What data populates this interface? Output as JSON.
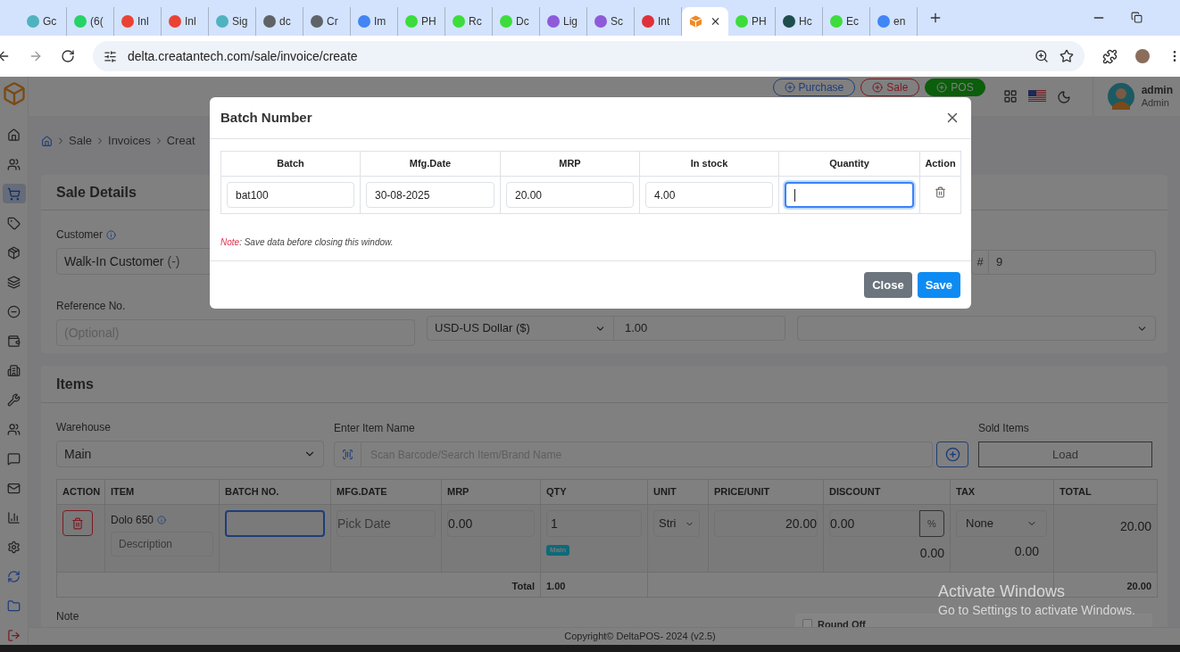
{
  "browser": {
    "tabs": [
      {
        "title": "Gc",
        "selected": false,
        "color": "#4fb3bf"
      },
      {
        "title": "(6(",
        "selected": false,
        "color": "#25d366"
      },
      {
        "title": "Inl",
        "selected": false,
        "color": "#ea4335"
      },
      {
        "title": "Inl",
        "selected": false,
        "color": "#ea4335"
      },
      {
        "title": "Sig",
        "selected": false,
        "color": "#4fb3bf"
      },
      {
        "title": "dc",
        "selected": false,
        "color": "#5f6368"
      },
      {
        "title": "Cr",
        "selected": false,
        "color": "#5f6368"
      },
      {
        "title": "Im",
        "selected": false,
        "color": "#4285f4"
      },
      {
        "title": "PH",
        "selected": false,
        "color": "#3ddc3d"
      },
      {
        "title": "Rc",
        "selected": false,
        "color": "#3ddc3d"
      },
      {
        "title": "Dc",
        "selected": false,
        "color": "#3ddc3d"
      },
      {
        "title": "Lig",
        "selected": false,
        "color": "#8e5bd8"
      },
      {
        "title": "Sc",
        "selected": false,
        "color": "#8e5bd8"
      },
      {
        "title": "Int",
        "selected": false,
        "color": "#e0303a"
      },
      {
        "selected": true,
        "color": "#f08a24"
      },
      {
        "title": "PH",
        "selected": false,
        "color": "#3ddc3d"
      },
      {
        "title": "Hc",
        "selected": false,
        "color": "#1e4d4d"
      },
      {
        "title": "Ec",
        "selected": false,
        "color": "#3ddc3d"
      },
      {
        "title": "en",
        "selected": false,
        "color": "#4285f4"
      }
    ],
    "url": "delta.creatantech.com/sale/invoice/create"
  },
  "sidebar": {
    "items": [
      {
        "selected": false
      },
      {
        "selected": false
      },
      {
        "selected": true
      },
      {
        "selected": false
      },
      {
        "selected": false
      },
      {
        "selected": false
      },
      {
        "selected": false
      },
      {
        "selected": false
      },
      {
        "selected": false
      },
      {
        "selected": false
      },
      {
        "selected": false
      },
      {
        "selected": false
      },
      {
        "selected": false
      },
      {
        "selected": false
      },
      {
        "selected": false
      },
      {
        "selected": false
      },
      {
        "selected": false
      },
      {
        "selected": false
      }
    ]
  },
  "header": {
    "buttons": [
      {
        "label": "Purchase",
        "kind": "purchase"
      },
      {
        "label": "Sale",
        "kind": "sale"
      },
      {
        "label": "POS",
        "kind": "pos"
      }
    ],
    "user": {
      "name": "admin",
      "role": "Admin"
    }
  },
  "breadcrumb": [
    "Sale",
    "Invoices",
    "Creat"
  ],
  "sale_details": {
    "title": "Sale Details",
    "customer_label": "Customer",
    "customer": "Walk-In Customer",
    "customer_suffix": "(-)",
    "number_prefix": "#",
    "number": "9",
    "reference_label": "Reference No.",
    "reference_placeholder": "(Optional)",
    "currency": "USD-US Dollar ($)",
    "exchange_rate": "1.00"
  },
  "items": {
    "title": "Items",
    "warehouse_label": "Warehouse",
    "warehouse": "Main",
    "search_label": "Enter Item Name",
    "search_placeholder": "Scan Barcode/Search Item/Brand Name",
    "sold_items_label": "Sold Items",
    "load_button": "Load",
    "columns": [
      "ACTION",
      "ITEM",
      "BATCH NO.",
      "MFG.DATE",
      "MRP",
      "QTY",
      "UNIT",
      "PRICE/UNIT",
      "DISCOUNT",
      "TAX",
      "TOTAL"
    ],
    "rows": [
      {
        "item": "Dolo 650",
        "description_placeholder": "Description",
        "batch": "",
        "mfg_placeholder": "Pick Date",
        "mrp": "0.00",
        "qty": "1",
        "warehouse_badge": "Main",
        "unit": "Stri",
        "price": "20.00",
        "discount": "0.00",
        "discount_type": "%",
        "discount_amount": "0.00",
        "tax": "None",
        "tax_amount": "0.00",
        "total": "20.00"
      }
    ],
    "total_label": "Total",
    "total_qty": "1.00",
    "total_amount": "20.00"
  },
  "note_label": "Note",
  "round_off": {
    "label": "Round Off",
    "checked": false
  },
  "footer": "Copyright© DeltaPOS- 2024 (v2.5)",
  "os_notice": {
    "title": "Activate Windows",
    "text": "Go to Settings to activate Windows."
  },
  "modal": {
    "title": "Batch Number",
    "columns": [
      "Batch",
      "Mfg.Date",
      "MRP",
      "In stock",
      "Quantity",
      "Action"
    ],
    "rows": [
      {
        "batch": "bat100",
        "mfg_date": "30-08-2025",
        "mrp": "20.00",
        "in_stock": "4.00",
        "quantity": ""
      }
    ],
    "note_label": "Note",
    "note_text": ": Save data before closing this window.",
    "buttons": [
      {
        "label": "Close",
        "kind": "secondary"
      },
      {
        "label": "Save",
        "kind": "primary"
      }
    ]
  }
}
